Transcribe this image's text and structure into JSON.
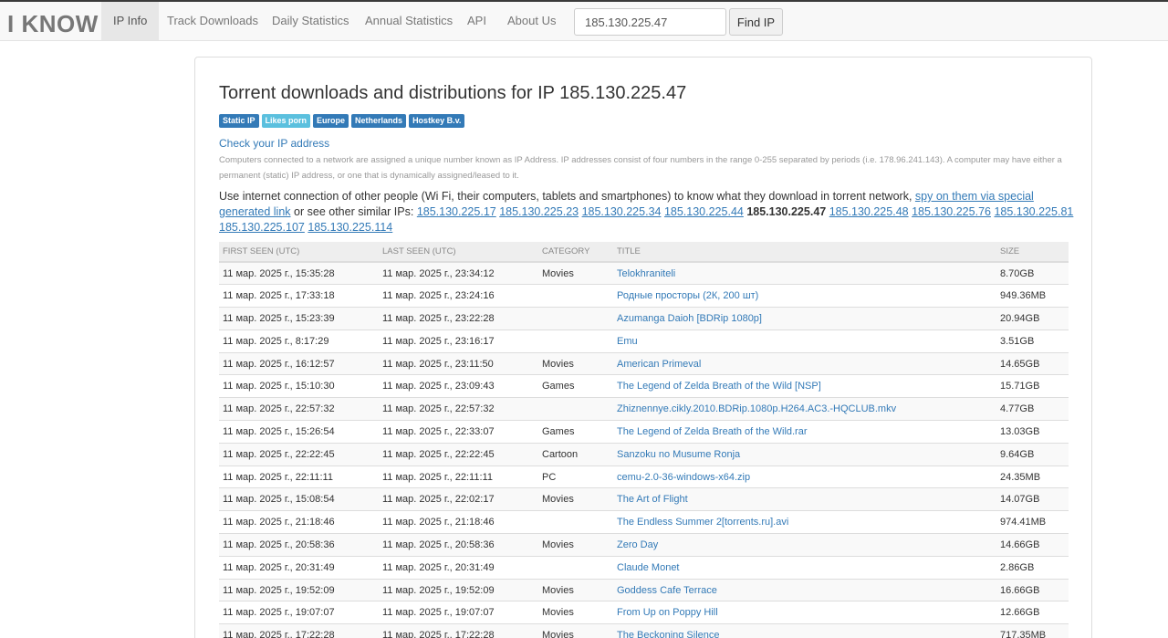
{
  "brand": "I KNOW",
  "nav": [
    {
      "label": "IP Info",
      "active": true
    },
    {
      "label": "Track Downloads"
    },
    {
      "label": "Daily Statistics"
    },
    {
      "label": "Annual Statistics"
    },
    {
      "label": "API"
    },
    {
      "label": "About Us"
    }
  ],
  "search": {
    "value": "185.130.225.47",
    "button": "Find IP"
  },
  "page": {
    "heading": "Torrent downloads and distributions for IP 185.130.225.47",
    "badges": [
      "Static IP",
      "Likes porn",
      "Europe",
      "Netherlands",
      "Hostkey B.v."
    ],
    "check_link": "Check your IP address",
    "description": "Computers connected to a network are assigned a unique number known as IP Address. IP addresses consist of four numbers in the range 0-255 separated by periods (i.e. 178.96.241.143). A computer may have either a permanent (static) IP address, or one that is dynamically assigned/leased to it.",
    "usage_text": "Use internet connection of other people (Wi Fi, their computers, tablets and smartphones) to know what they download in torrent network,",
    "spy_link": "spy on them via special generated link",
    "or_text": "or",
    "similar_text": "see other similar IPs:",
    "similar_ips": [
      "185.130.225.17",
      "185.130.225.23",
      "185.130.225.34",
      "185.130.225.44",
      "185.130.225.47",
      "185.130.225.48",
      "185.130.225.76",
      "185.130.225.81",
      "185.130.225.107",
      "185.130.225.114"
    ],
    "current_ip": "185.130.225.47"
  },
  "table": {
    "headers": [
      "FIRST SEEN (UTC)",
      "LAST SEEN (UTC)",
      "CATEGORY",
      "TITLE",
      "SIZE"
    ],
    "rows": [
      [
        "11 мар. 2025 г., 15:35:28",
        "11 мар. 2025 г., 23:34:12",
        "Movies",
        "Telokhraniteli",
        "8.70GB"
      ],
      [
        "11 мар. 2025 г., 17:33:18",
        "11 мар. 2025 г., 23:24:16",
        "",
        "Родные просторы (2К, 200 шт)",
        "949.36MB"
      ],
      [
        "11 мар. 2025 г., 15:23:39",
        "11 мар. 2025 г., 23:22:28",
        "",
        "Azumanga Daioh [BDRip 1080p]",
        "20.94GB"
      ],
      [
        "11 мар. 2025 г., 8:17:29",
        "11 мар. 2025 г., 23:16:17",
        "",
        "Emu",
        "3.51GB"
      ],
      [
        "11 мар. 2025 г., 16:12:57",
        "11 мар. 2025 г., 23:11:50",
        "Movies",
        "American Primeval",
        "14.65GB"
      ],
      [
        "11 мар. 2025 г., 15:10:30",
        "11 мар. 2025 г., 23:09:43",
        "Games",
        "The Legend of Zelda Breath of the Wild [NSP]",
        "15.71GB"
      ],
      [
        "11 мар. 2025 г., 22:57:32",
        "11 мар. 2025 г., 22:57:32",
        "",
        "Zhiznennye.cikly.2010.BDRip.1080p.H264.AC3.-HQCLUB.mkv",
        "4.77GB"
      ],
      [
        "11 мар. 2025 г., 15:26:54",
        "11 мар. 2025 г., 22:33:07",
        "Games",
        "The Legend of Zelda Breath of the Wild.rar",
        "13.03GB"
      ],
      [
        "11 мар. 2025 г., 22:22:45",
        "11 мар. 2025 г., 22:22:45",
        "Cartoon",
        "Sanzoku no Musume Ronja",
        "9.64GB"
      ],
      [
        "11 мар. 2025 г., 22:11:11",
        "11 мар. 2025 г., 22:11:11",
        "PC",
        "cemu-2.0-36-windows-x64.zip",
        "24.35MB"
      ],
      [
        "11 мар. 2025 г., 15:08:54",
        "11 мар. 2025 г., 22:02:17",
        "Movies",
        "The Art of Flight",
        "14.07GB"
      ],
      [
        "11 мар. 2025 г., 21:18:46",
        "11 мар. 2025 г., 21:18:46",
        "",
        "The Endless Summer 2[torrents.ru].avi",
        "974.41MB"
      ],
      [
        "11 мар. 2025 г., 20:58:36",
        "11 мар. 2025 г., 20:58:36",
        "Movies",
        "Zero Day",
        "14.66GB"
      ],
      [
        "11 мар. 2025 г., 20:31:49",
        "11 мар. 2025 г., 20:31:49",
        "",
        "Claude Monet",
        "2.86GB"
      ],
      [
        "11 мар. 2025 г., 19:52:09",
        "11 мар. 2025 г., 19:52:09",
        "Movies",
        "Goddess Cafe Terrace",
        "16.66GB"
      ],
      [
        "11 мар. 2025 г., 19:07:07",
        "11 мар. 2025 г., 19:07:07",
        "Movies",
        "From Up on Poppy Hill",
        "12.66GB"
      ],
      [
        "11 мар. 2025 г., 17:22:28",
        "11 мар. 2025 г., 17:22:28",
        "Movies",
        "The Beckoning Silence",
        "717.35MB"
      ]
    ]
  }
}
